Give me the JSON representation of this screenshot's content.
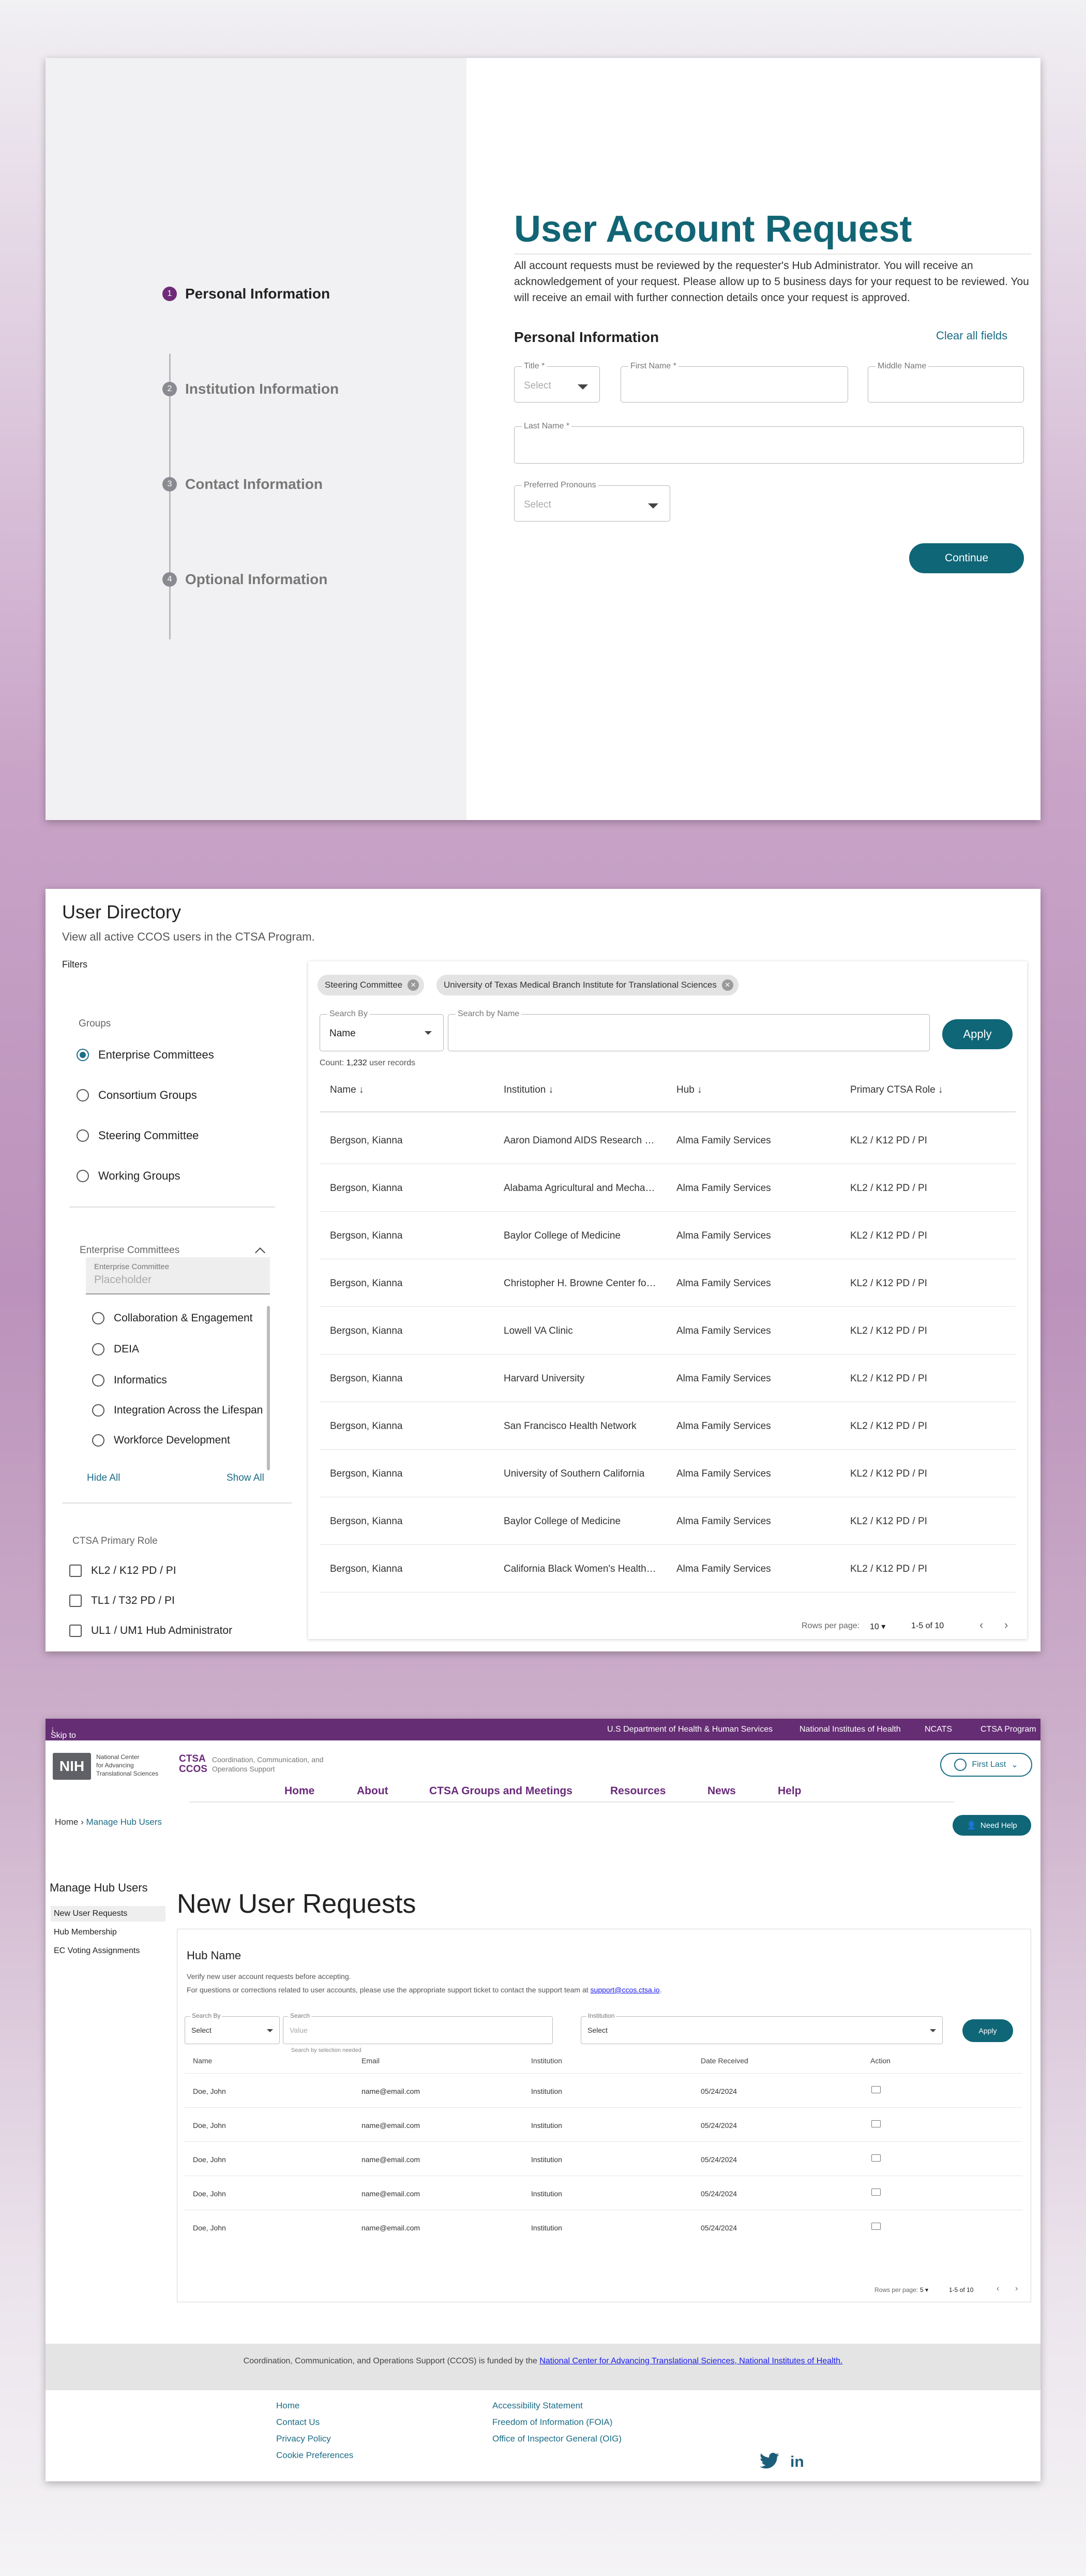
{
  "request": {
    "steps": [
      {
        "num": "1",
        "label": "Personal Information"
      },
      {
        "num": "2",
        "label": "Institution Information"
      },
      {
        "num": "3",
        "label": "Contact Information"
      },
      {
        "num": "4",
        "label": "Optional Information"
      }
    ],
    "title": "User Account Request",
    "intro": "All account requests must be reviewed by the requester's Hub Administrator. You will receive an acknowledgement of your request. Please allow up to 5 business days for your request to be reviewed. You will receive an email with further connection details once your request is approved.",
    "section": "Personal Information",
    "clear_all": "Clear all fields",
    "fields": {
      "title_label": "Title *",
      "title_placeholder": "Select",
      "first_name_label": "First Name *",
      "middle_name_label": "Middle Name",
      "last_name_label": "Last Name *",
      "pronouns_label": "Preferred Pronouns",
      "pronouns_placeholder": "Select"
    },
    "continue": "Continue"
  },
  "directory": {
    "title": "User Directory",
    "subtitle": "View all active CCOS users in the CTSA Program.",
    "filters_label": "Filters",
    "groups_title": "Groups",
    "groups": [
      "Enterprise Committees",
      "Consortium Groups",
      "Steering Committee",
      "Working Groups"
    ],
    "ec_title": "Enterprise Committees",
    "ec_input_label": "Enterprise Committee",
    "ec_input_placeholder": "Placeholder",
    "ec_options": [
      "Collaboration & Engagement",
      "DEIA",
      "Informatics",
      "Integration Across the Lifespan",
      "Workforce Development"
    ],
    "hide_all": "Hide All",
    "show_all": "Show All",
    "role_title": "CTSA Primary Role",
    "roles": [
      "KL2 / K12 PD / PI",
      "TL1 / T32 PD / PI",
      "UL1 / UM1 Hub Administrator"
    ],
    "chips": [
      "Steering Committee",
      "University of Texas Medical Branch Institute for Translational Sciences"
    ],
    "search_by_label": "Search By",
    "search_by_value": "Name",
    "search_name_label": "Search by Name",
    "apply": "Apply",
    "count_prefix": "Count: ",
    "count_value": "1,232",
    "count_suffix": " user records",
    "columns": [
      "Name",
      "Institution",
      "Hub",
      "Primary CTSA Role"
    ],
    "rows": [
      [
        "Bergson, Kianna",
        "Aaron Diamond AIDS Research Center",
        "Alma Family Services",
        "KL2 / K12 PD / PI"
      ],
      [
        "Bergson, Kianna",
        "Alabama Agricultural and Mechanical University",
        "Alma Family Services",
        "KL2 / K12 PD / PI"
      ],
      [
        "Bergson, Kianna",
        "Baylor College of Medicine",
        "Alma Family Services",
        "KL2 / K12 PD / PI"
      ],
      [
        "Bergson, Kianna",
        "Christopher H. Browne Center for the Study of...",
        "Alma Family Services",
        "KL2 / K12 PD / PI"
      ],
      [
        "Bergson, Kianna",
        "Lowell VA Clinic",
        "Alma Family Services",
        "KL2 / K12 PD / PI"
      ],
      [
        "Bergson, Kianna",
        "Harvard University",
        "Alma Family Services",
        "KL2 / K12 PD / PI"
      ],
      [
        "Bergson, Kianna",
        "San Francisco Health Network",
        "Alma Family Services",
        "KL2 / K12 PD / PI"
      ],
      [
        "Bergson, Kianna",
        "University of Southern California",
        "Alma Family Services",
        "KL2 / K12 PD / PI"
      ],
      [
        "Bergson, Kianna",
        "Baylor College of Medicine",
        "Alma Family Services",
        "KL2 / K12 PD / PI"
      ],
      [
        "Bergson, Kianna",
        "California Black Women's Health Project",
        "Alma Family Services",
        "KL2 / K12 PD / PI"
      ]
    ],
    "rows_per_page_label": "Rows per page:",
    "rows_per_page": "10",
    "range": "1-5 of 10"
  },
  "hub": {
    "skip": "Skip to main content",
    "gov_links": [
      "U.S Department of Health & Human Services",
      "National Institutes of Health",
      "NCATS",
      "CTSA Program"
    ],
    "nih_logo": "NIH",
    "nih_text": [
      "National Center",
      "for Advancing",
      "Translational Sciences"
    ],
    "ctsa_logo": [
      "CTSA",
      "CCOS"
    ],
    "ctsa_sub": [
      "Coordination, Communication, and",
      "Operations Support"
    ],
    "user": "First Last",
    "nav": [
      "Home",
      "About",
      "CTSA Groups and Meetings",
      "Resources",
      "News",
      "Help"
    ],
    "need_help": "Need Help",
    "breadcrumb_home": "Home",
    "breadcrumb_sep": " › ",
    "breadcrumb_current": "Manage Hub Users",
    "side_title": "Manage Hub Users",
    "side_items": [
      "New User Requests",
      "Hub Membership",
      "EC Voting Assignments"
    ],
    "page_title": "New User Requests",
    "hub_name": "Hub Name",
    "desc1": "Verify new user account requests before accepting.",
    "desc2": "For questions or corrections related to user accounts, please use the appropriate support ticket to contact the support team at",
    "support_email": "support@ccos.ctsa.io",
    "search_by_label": "Search By",
    "search_by_value": "Select",
    "search_label": "Search",
    "search_placeholder": "Value",
    "search_hint": "Search by selection needed",
    "institution_label": "Institution",
    "institution_value": "Select",
    "apply": "Apply",
    "columns": [
      "Name",
      "Email",
      "Institution",
      "Date Received",
      "Action"
    ],
    "rows": [
      [
        "Doe, John",
        "name@email.com",
        "Institution",
        "05/24/2024"
      ],
      [
        "Doe, John",
        "name@email.com",
        "Institution",
        "05/24/2024"
      ],
      [
        "Doe, John",
        "name@email.com",
        "Institution",
        "05/24/2024"
      ],
      [
        "Doe, John",
        "name@email.com",
        "Institution",
        "05/24/2024"
      ],
      [
        "Doe, John",
        "name@email.com",
        "Institution",
        "05/24/2024"
      ]
    ],
    "rows_per_page_label": "Rows per page:",
    "rows_per_page": "5",
    "range": "1-5 of 10",
    "funded_text": "Coordination, Communication, and Operations Support (CCOS) is funded by the",
    "funded_link": "National Center for Advancing Translational Sciences, National Institutes of Health.",
    "footer_col1": [
      "Home",
      "Contact Us",
      "Privacy Policy",
      "Cookie Preferences"
    ],
    "footer_col2": [
      "Accessibility Statement",
      "Freedom of Information (FOIA)",
      "Office of Inspector General (OIG)"
    ]
  },
  "colors": {
    "teal": "#0f6677",
    "purple": "#652d74",
    "link": "#1b6c86"
  }
}
